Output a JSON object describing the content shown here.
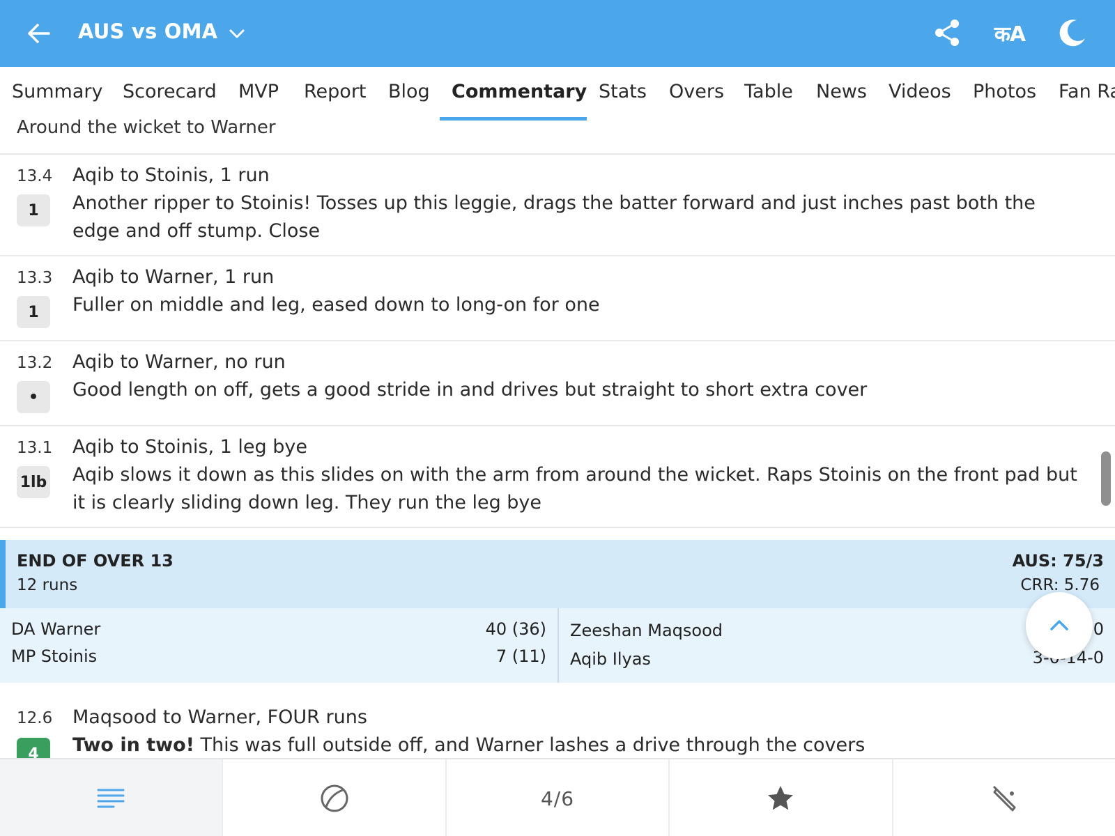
{
  "header": {
    "title": "AUS vs OMA",
    "lang_icon_text": "कA",
    "background": "#4ca6ea"
  },
  "tabs": [
    {
      "label": "Summary"
    },
    {
      "label": "Scorecard"
    },
    {
      "label": "MVP"
    },
    {
      "label": "Report"
    },
    {
      "label": "Blog"
    },
    {
      "label": "Commentary",
      "active": true
    },
    {
      "label": "Stats"
    },
    {
      "label": "Overs"
    },
    {
      "label": "Table"
    },
    {
      "label": "News"
    },
    {
      "label": "Videos"
    },
    {
      "label": "Photos"
    },
    {
      "label": "Fan Ra"
    }
  ],
  "subline": "Around the wicket to Warner",
  "balls": [
    {
      "over": "13.4",
      "runs": "1",
      "heading": "Aqib to Stoinis, 1 run",
      "text": "Another ripper to Stoinis! Tosses up this leggie, drags the batter forward and just inches past both the edge and off stump. Close"
    },
    {
      "over": "13.3",
      "runs": "1",
      "heading": "Aqib to Warner, 1 run",
      "text": "Fuller on middle and leg, eased down to long-on for one"
    },
    {
      "over": "13.2",
      "runs": "•",
      "heading": "Aqib to Warner, no run",
      "text": "Good length on off, gets a good stride in and drives but straight to short extra cover"
    },
    {
      "over": "13.1",
      "runs": "1lb",
      "heading": "Aqib to Stoinis, 1 leg bye",
      "text": "Aqib slows it down as this slides on with the arm from around the wicket. Raps Stoinis on the front pad but it is clearly sliding down leg. They run the leg bye"
    },
    {
      "over": "12.6",
      "runs": "4",
      "heading": "Maqsood to Warner, FOUR runs",
      "text_bold": "Two in two!",
      "text": " This was full outside off, and Warner lashes a drive through the covers"
    }
  ],
  "end_of_over": {
    "title": "END OF OVER 13",
    "runs": "12 runs",
    "score": "AUS: 75/3",
    "crr": "CRR: 5.76"
  },
  "batters": [
    {
      "name": "DA Warner",
      "score": "40 (36)"
    },
    {
      "name": "MP Stoinis",
      "score": "7 (11)"
    }
  ],
  "bowlers": [
    {
      "name": "Zeeshan Maqsood",
      "figures": "0"
    },
    {
      "name": "Aqib Ilyas",
      "figures": "3-0-14-0"
    }
  ],
  "bottom_nav": {
    "pager": "4/6"
  },
  "colors": {
    "accent": "#4ca6ea",
    "four": "#3a9e5f",
    "end_of_over_bg": "#d4eaf9"
  }
}
